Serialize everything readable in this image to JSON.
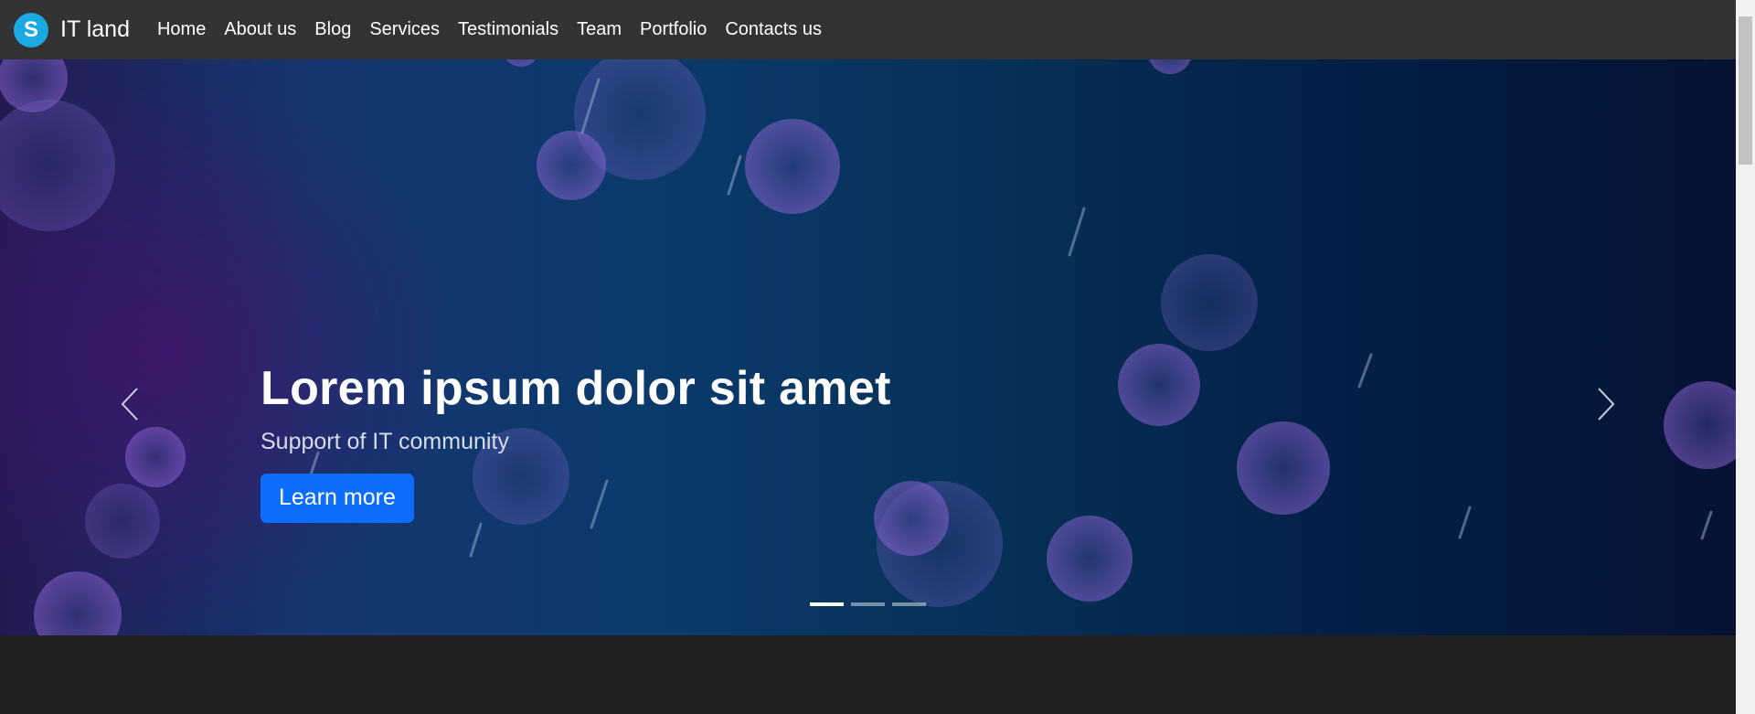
{
  "brand": {
    "logo_letter": "S",
    "name": "IT land"
  },
  "nav": {
    "items": [
      {
        "label": "Home"
      },
      {
        "label": "About us"
      },
      {
        "label": "Blog"
      },
      {
        "label": "Services"
      },
      {
        "label": "Testimonials"
      },
      {
        "label": "Team"
      },
      {
        "label": "Portfolio"
      },
      {
        "label": "Contacts us"
      }
    ]
  },
  "hero": {
    "title": "Lorem ipsum dolor sit amet",
    "subtitle": "Support of IT community",
    "cta_label": "Learn more",
    "prev_icon": "chevron-left-icon",
    "next_icon": "chevron-right-icon",
    "slide_count": 3,
    "active_slide": 1
  },
  "colors": {
    "navbar_bg": "#333333",
    "page_bg": "#212121",
    "accent": "#0d6efd",
    "logo_bg": "#1ba9e1"
  }
}
